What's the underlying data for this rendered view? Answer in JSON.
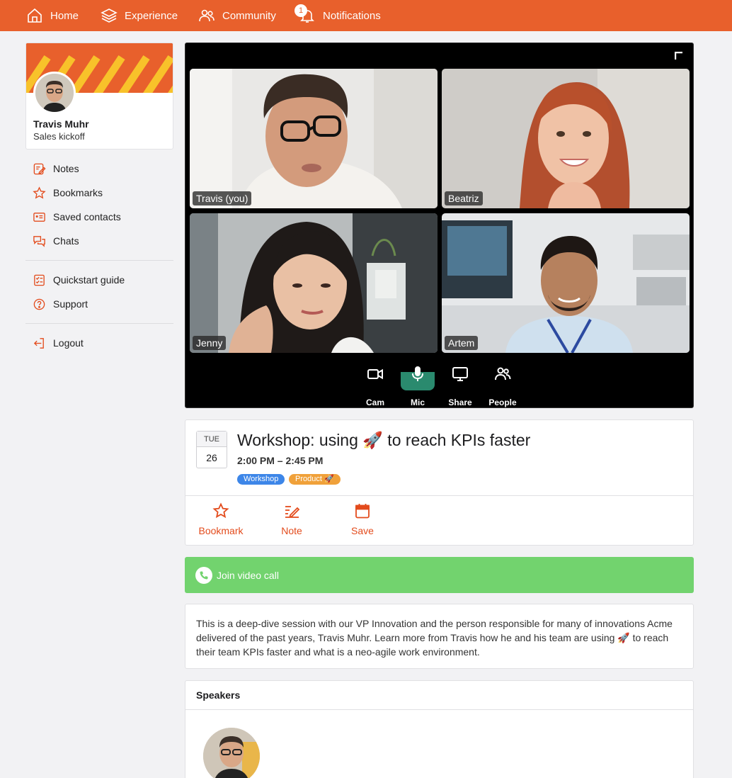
{
  "nav": {
    "items": [
      {
        "label": "Home",
        "icon": "home-icon"
      },
      {
        "label": "Experience",
        "icon": "layers-icon"
      },
      {
        "label": "Community",
        "icon": "users-icon"
      },
      {
        "label": "Notifications",
        "icon": "bell-icon",
        "badge": "1"
      }
    ]
  },
  "profile": {
    "name": "Travis Muhr",
    "subtitle": "Sales kickoff"
  },
  "sidebar": {
    "items": [
      {
        "label": "Notes",
        "icon": "notes-icon"
      },
      {
        "label": "Bookmarks",
        "icon": "star-icon"
      },
      {
        "label": "Saved contacts",
        "icon": "contact-card-icon"
      },
      {
        "label": "Chats",
        "icon": "chat-icon"
      },
      {
        "label": "Quickstart guide",
        "icon": "checklist-icon"
      },
      {
        "label": "Support",
        "icon": "help-icon"
      },
      {
        "label": "Logout",
        "icon": "logout-icon"
      }
    ]
  },
  "video": {
    "participants": [
      {
        "label": "Travis (you)"
      },
      {
        "label": "Beatriz"
      },
      {
        "label": "Jenny"
      },
      {
        "label": "Artem"
      }
    ],
    "controls": [
      {
        "label": "Cam",
        "icon": "camera-icon",
        "active": false
      },
      {
        "label": "Mic",
        "icon": "microphone-icon",
        "active": true
      },
      {
        "label": "Share",
        "icon": "screen-share-icon",
        "active": false
      },
      {
        "label": "People",
        "icon": "people-icon",
        "active": false
      }
    ]
  },
  "event": {
    "date_dow": "TUE",
    "date_day": "26",
    "title": "Workshop: using 🚀 to reach KPIs faster",
    "time": "2:00 PM – 2:45 PM",
    "tags": [
      {
        "label": "Workshop",
        "color": "#3d86e8"
      },
      {
        "label": "Product 🚀",
        "color": "#f0a13a"
      }
    ],
    "actions": [
      {
        "label": "Bookmark",
        "icon": "star-icon"
      },
      {
        "label": "Note",
        "icon": "edit-note-icon"
      },
      {
        "label": "Save",
        "icon": "calendar-icon"
      }
    ]
  },
  "join": {
    "label": "Join video call"
  },
  "description": "This is a deep-dive session with our VP Innovation and the person responsible for many of innovations Acme delivered of the past years, Travis Muhr. Learn more from Travis how he and his team are using 🚀 to reach their team KPIs faster and what is a neo-agile work environment.",
  "speakers": {
    "title": "Speakers"
  },
  "colors": {
    "brand": "#e8602c",
    "accent": "#e34b1c",
    "join_green": "#72d36e",
    "mic_active": "#2a8a6e"
  }
}
